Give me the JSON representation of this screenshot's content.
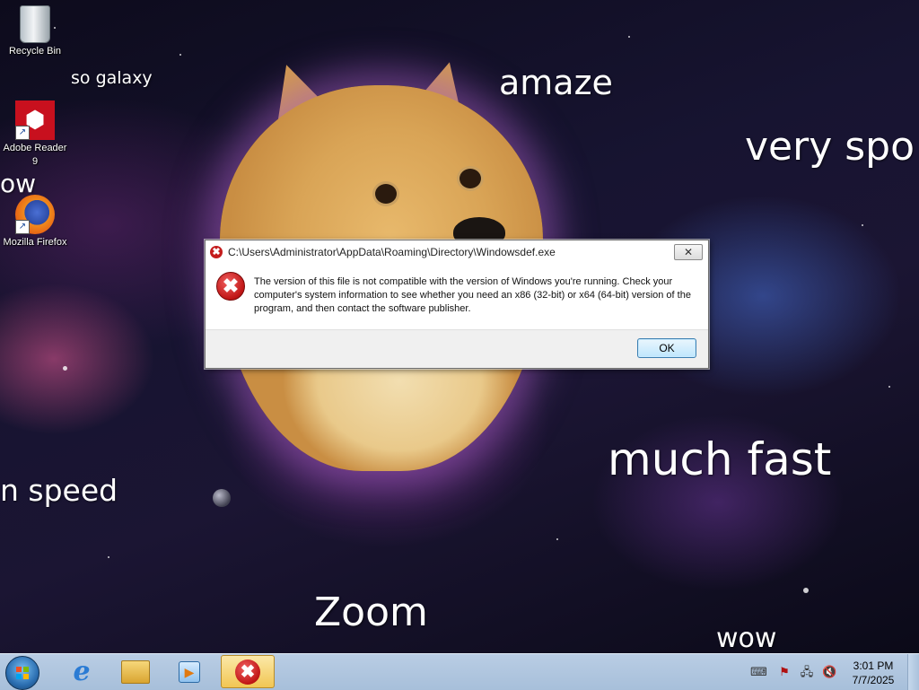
{
  "desktop": {
    "icons": [
      {
        "label": "Recycle Bin",
        "icon": "recycle-bin-icon"
      },
      {
        "label": "Adobe Reader 9",
        "icon": "adobe-reader-icon"
      },
      {
        "label": "Mozilla Firefox",
        "icon": "firefox-icon"
      }
    ],
    "wallpaper_text": [
      "so galaxy",
      "amaze",
      "very spo",
      "ow",
      "n speed",
      "much fast",
      "Zoom",
      "wow"
    ]
  },
  "dialog": {
    "title": "C:\\Users\\Administrator\\AppData\\Roaming\\Directory\\Windowsdef.exe",
    "message": "The version of this file is not compatible with the version of Windows you're running. Check your computer's system information to see whether you need an x86 (32-bit) or x64 (64-bit) version of the program, and then contact the software publisher.",
    "ok_label": "OK",
    "close_glyph": "✕",
    "error_glyph": "✖"
  },
  "taskbar": {
    "pinned": [
      {
        "name": "Internet Explorer",
        "icon": "internet-explorer-icon"
      },
      {
        "name": "Windows Explorer",
        "icon": "folder-icon"
      },
      {
        "name": "Windows Media Player",
        "icon": "media-player-icon"
      }
    ],
    "active_task_icon": "error-icon",
    "tray_icons": [
      "keyboard-icon",
      "action-center-flag-icon",
      "network-icon",
      "volume-muted-icon"
    ],
    "clock": {
      "time": "3:01 PM",
      "date": "7/7/2025"
    }
  },
  "colors": {
    "error_red": "#c41c1c",
    "taskbar": "#b9cde4",
    "ok_button_border": "#3c7fb1"
  }
}
